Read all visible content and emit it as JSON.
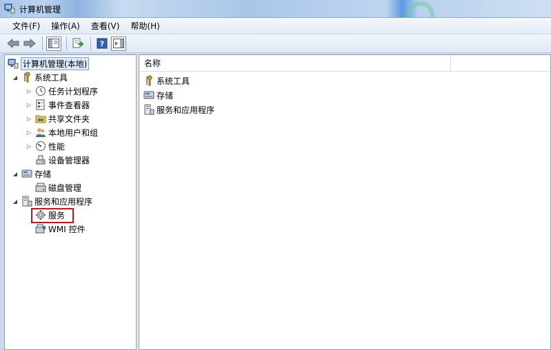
{
  "window": {
    "title": "计算机管理"
  },
  "menu": [
    "文件(F)",
    "操作(A)",
    "查看(V)",
    "帮助(H)"
  ],
  "toolbar": {
    "buttons": [
      "back-icon",
      "forward-icon",
      "show-hide-tree-icon",
      "export-list-icon",
      "help-icon",
      "show-hide-action-pane-icon"
    ]
  },
  "tree": {
    "root": "计算机管理(本地)",
    "system_tools": "系统工具",
    "task_scheduler": "任务计划程序",
    "event_viewer": "事件查看器",
    "shared_folders": "共享文件夹",
    "local_users": "本地用户和组",
    "performance": "性能",
    "device_manager": "设备管理器",
    "storage": "存储",
    "disk_management": "磁盘管理",
    "services_apps": "服务和应用程序",
    "services": "服务",
    "wmi": "WMI 控件"
  },
  "list": {
    "column_name": "名称",
    "items": [
      "系统工具",
      "存储",
      "服务和应用程序"
    ]
  },
  "colors": {
    "highlight": "#d01010",
    "selection": "#dcebfc"
  }
}
